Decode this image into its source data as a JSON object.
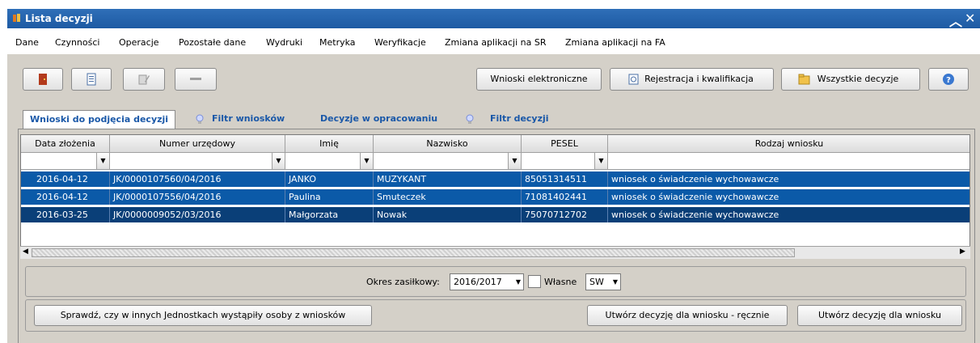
{
  "window": {
    "title": "Lista decyzji"
  },
  "menu": [
    "Dane",
    "Czynności",
    "Operacje",
    "Pozostałe dane",
    "Wydruki",
    "Metryka",
    "Weryfikacje",
    "Zmiana aplikacji na SR",
    "Zmiana aplikacji na FA"
  ],
  "toolbar": {
    "wnioski_elektroniczne": "Wnioski elektroniczne",
    "rejestracja": "Rejestracja i kwalifikacja",
    "wszystkie_decyzje": "Wszystkie decyzje"
  },
  "tabs": [
    "Wnioski do podjęcia decyzji",
    "Filtr wniosków",
    "Decyzje w opracowaniu",
    "Filtr decyzji"
  ],
  "grid": {
    "columns": [
      "Data złożenia",
      "Numer urzędowy",
      "Imię",
      "Nazwisko",
      "PESEL",
      "Rodzaj wniosku"
    ],
    "rows": [
      [
        "2016-04-12",
        "JK/0000107560/04/2016",
        "JANKO",
        "MUZYKANT",
        "85051314511",
        "wniosek o świadczenie wychowawcze"
      ],
      [
        "2016-04-12",
        "JK/0000107556/04/2016",
        "Paulina",
        "Smuteczek",
        "71081402441",
        "wniosek o świadczenie wychowawcze"
      ],
      [
        "2016-03-25",
        "JK/0000009052/03/2016",
        "Małgorzata",
        "Nowak",
        "75070712702",
        "wniosek o świadczenie wychowawcze"
      ]
    ]
  },
  "filters": {
    "okres_label": "Okres zasiłkowy:",
    "okres_value": "2016/2017",
    "wlasne_label": "Własne",
    "sw_value": "SW"
  },
  "actions": {
    "sprawdz": "Sprawdź, czy w innych Jednostkach wystąpiły osoby z wniosków",
    "utworz_recznie": "Utwórz decyzję dla wniosku - ręcznie",
    "utworz": "Utwórz decyzję dla wniosku"
  },
  "colors": {
    "title_bar": "#1d5aa3",
    "row_selected": "#0b5aa8",
    "row_focus": "#0a3f78",
    "tab_text": "#1a58a8"
  }
}
